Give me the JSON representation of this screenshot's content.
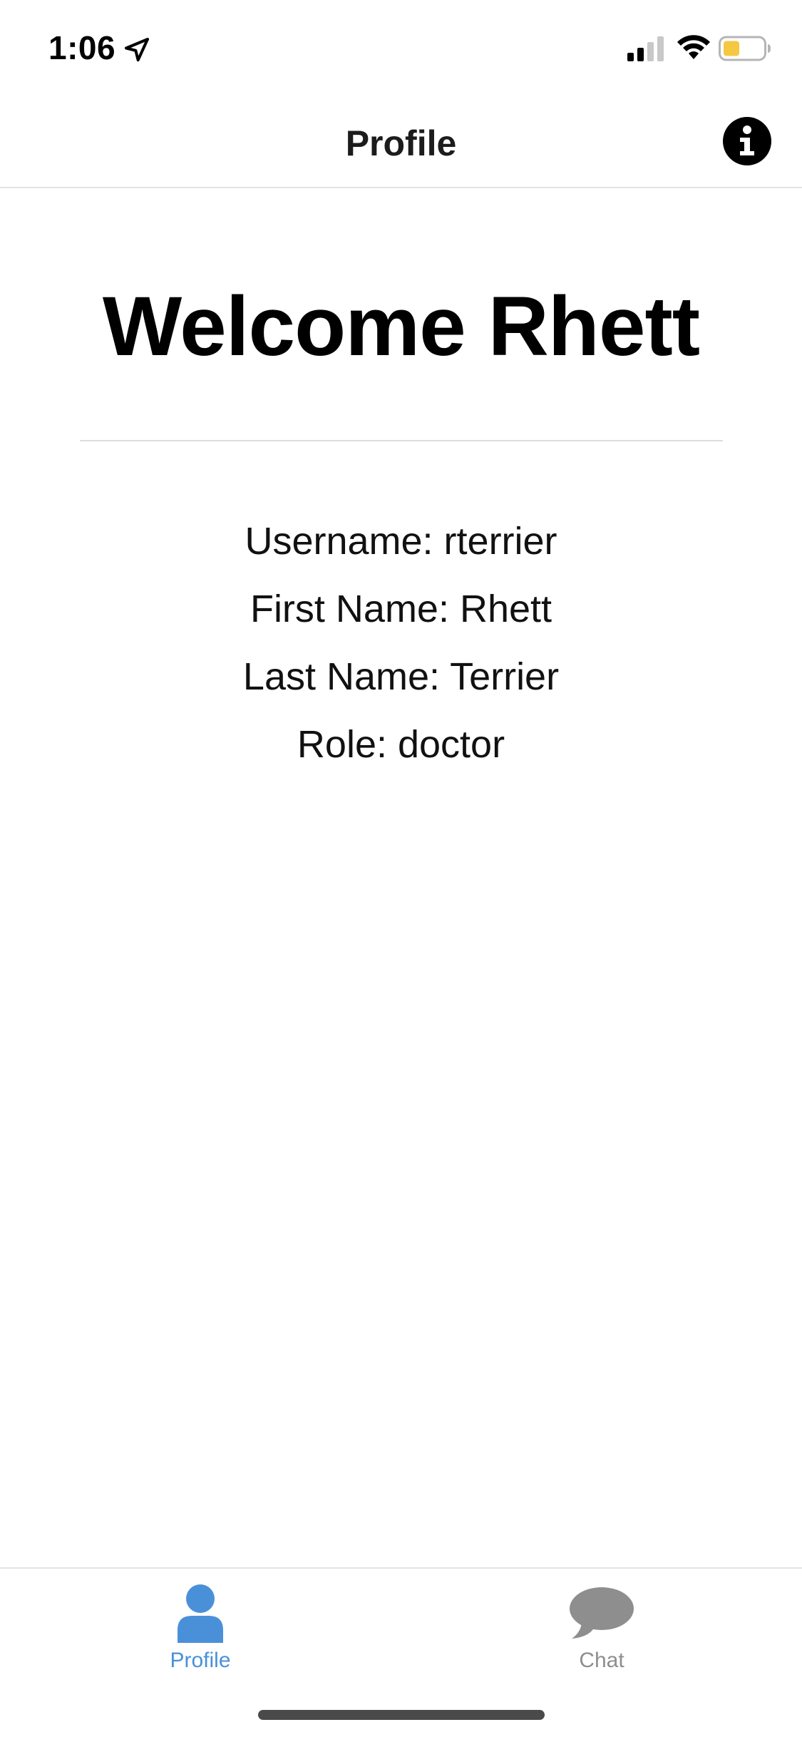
{
  "status_bar": {
    "time": "1:06",
    "battery_color": "#f5c842"
  },
  "nav": {
    "title": "Profile",
    "info_icon": "info-icon"
  },
  "content": {
    "welcome": "Welcome Rhett",
    "details": {
      "username": "Username: rterrier",
      "first_name": "First Name: Rhett",
      "last_name": "Last Name: Terrier",
      "role": "Role: doctor"
    }
  },
  "tab_bar": {
    "active_color": "#4a90d9",
    "inactive_color": "#8e8e8e",
    "tabs": [
      {
        "label": "Profile",
        "icon": "person-icon",
        "active": true
      },
      {
        "label": "Chat",
        "icon": "chat-bubble-icon",
        "active": false
      }
    ]
  }
}
